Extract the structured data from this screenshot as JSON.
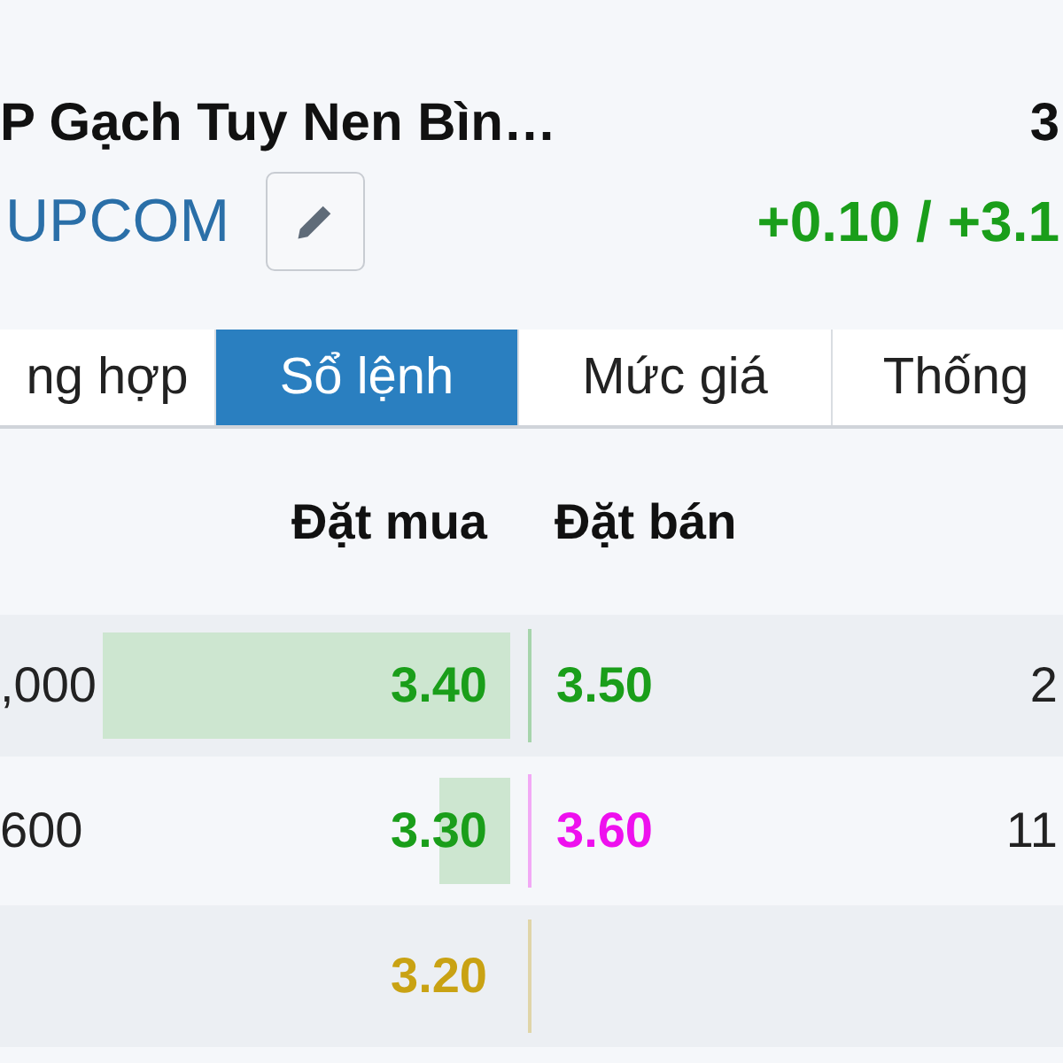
{
  "stock": {
    "name": "P Gạch Tuy Nen Bìn…",
    "price": "3",
    "exchange": "UPCOM",
    "change": "+0.10 / +3.1"
  },
  "tabs": [
    {
      "label": "ng hợp",
      "selected": false
    },
    {
      "label": "Sổ lệnh",
      "selected": true
    },
    {
      "label": "Mức giá",
      "selected": false
    },
    {
      "label": "Thống",
      "selected": false
    }
  ],
  "order_book": {
    "columns": [
      "Đặt mua",
      "Đặt bán"
    ],
    "rows": [
      {
        "bid": {
          "volume": ",000",
          "price": "3.40",
          "color": "#1a9e1a"
        },
        "ask": {
          "price": "3.50",
          "color": "#1a9e1a",
          "volume": "2"
        }
      },
      {
        "bid": {
          "volume": "600",
          "price": "3.30",
          "color": "#1a9e1a"
        },
        "ask": {
          "price": "3.60",
          "color": "#ee10ee",
          "volume": "11"
        }
      },
      {
        "bid": {
          "price": "3.20",
          "color": "#c9a213"
        }
      }
    ]
  }
}
